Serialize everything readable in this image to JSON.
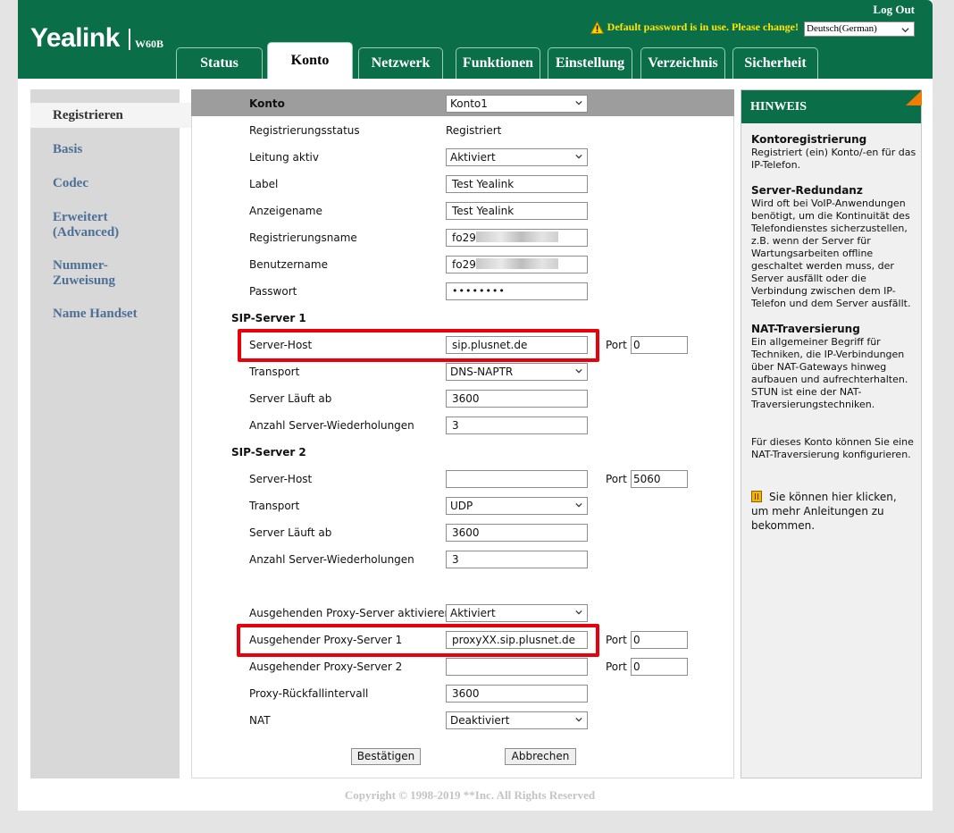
{
  "header": {
    "brand": "Yealink",
    "model": "W60B",
    "logout": "Log Out",
    "warning": "Default password is in use. Please change!",
    "language": "Deutsch(German)"
  },
  "tabs": [
    "Status",
    "Konto",
    "Netzwerk",
    "Funktionen",
    "Einstellung",
    "Verzeichnis",
    "Sicherheit"
  ],
  "active_tab": "Konto",
  "sidebar": {
    "items": [
      "Registrieren",
      "Basis",
      "Codec",
      "Erweitert\n(Advanced)",
      "Nummer-\nZuweisung",
      "Name Handset"
    ]
  },
  "form": {
    "konto_label": "Konto",
    "konto_value": "Konto1",
    "reg_status_label": "Registrierungsstatus",
    "reg_status_value": "Registriert",
    "leitung_label": "Leitung aktiv",
    "leitung_value": "Aktiviert",
    "label_label": "Label",
    "label_value": "Test Yealink",
    "anzeigename_label": "Anzeigename",
    "anzeigename_value": "Test Yealink",
    "regname_label": "Registrierungsname",
    "regname_value": "fo29",
    "benutzer_label": "Benutzername",
    "benutzer_value": "fo29",
    "passwort_label": "Passwort",
    "passwort_value": "••••••••",
    "sip1_title": "SIP-Server 1",
    "sip1_host_label": "Server-Host",
    "sip1_host_value": "sip.plusnet.de",
    "sip1_port_label": "Port",
    "sip1_port_value": "0",
    "sip1_transport_label": "Transport",
    "sip1_transport_value": "DNS-NAPTR",
    "sip1_expires_label": "Server Läuft ab",
    "sip1_expires_value": "3600",
    "sip1_retry_label": "Anzahl Server-Wiederholungen",
    "sip1_retry_value": "3",
    "sip2_title": "SIP-Server 2",
    "sip2_host_label": "Server-Host",
    "sip2_host_value": "",
    "sip2_port_label": "Port",
    "sip2_port_value": "5060",
    "sip2_transport_label": "Transport",
    "sip2_transport_value": "UDP",
    "sip2_expires_label": "Server Läuft ab",
    "sip2_expires_value": "3600",
    "sip2_retry_label": "Anzahl Server-Wiederholungen",
    "sip2_retry_value": "3",
    "proxy_enable_label": "Ausgehenden Proxy-Server aktivieren",
    "proxy_enable_value": "Aktiviert",
    "proxy1_label": "Ausgehender Proxy-Server 1",
    "proxy1_value": "proxyXX.sip.plusnet.de",
    "proxy1_port_label": "Port",
    "proxy1_port_value": "0",
    "proxy2_label": "Ausgehender Proxy-Server 2",
    "proxy2_value": "",
    "proxy2_port_label": "Port",
    "proxy2_port_value": "0",
    "fallback_label": "Proxy-Rückfallintervall",
    "fallback_value": "3600",
    "nat_label": "NAT",
    "nat_value": "Deaktiviert",
    "confirm": "Bestätigen",
    "cancel": "Abbrechen"
  },
  "hint": {
    "title": "HINWEIS",
    "s1_title": "Kontoregistrierung",
    "s1_text": "Registriert (ein) Konto/-en für das IP-Telefon.",
    "s2_title": "Server-Redundanz",
    "s2_text": "Wird oft bei VoIP-Anwendungen benötigt, um die Kontinuität des Telefondienstes sicherzustellen, z.B. wenn der Server für Wartungsarbeiten offline geschaltet werden muss, der Server ausfällt oder die Verbindung zwischen dem IP-Telefon und dem Server ausfällt.",
    "s3_title": "NAT-Traversierung",
    "s3_text": "Ein allgemeiner Begriff für Techniken, die IP-Verbindungen über NAT-Gateways hinweg aufbauen und aufrechterhalten. STUN ist eine der NAT-Traversierungstechniken.",
    "s4_text": "Für dieses Konto können Sie eine NAT-Traversierung konfigurieren.",
    "s5_text": "Sie können hier klicken, um mehr Anleitungen zu bekommen."
  },
  "footer": {
    "copyright": "Copyright © 1998-2019 **Inc. All Rights Reserved"
  },
  "colors": {
    "header_green": "#0a6e48",
    "nav_link": "#4c6f96",
    "highlight_red": "#e8000a",
    "hint_corner": "#f07c00",
    "warning_yellow": "#ffe600"
  }
}
